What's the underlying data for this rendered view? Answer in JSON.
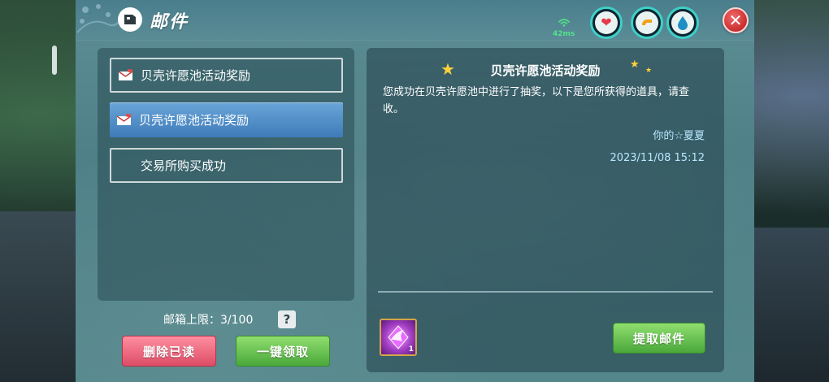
{
  "header": {
    "title": "邮件",
    "ping": "42ms",
    "icons": {
      "mail": "mail-badge-icon",
      "ping": "wifi-signal-icon",
      "mood": "heart-icon",
      "food": "food-icon",
      "water": "water-drop-icon",
      "close": "close-icon"
    }
  },
  "mail_list": {
    "items": [
      {
        "label": "贝壳许愿池活动奖励",
        "icon": "envelope-icon",
        "selected": false
      },
      {
        "label": "贝壳许愿池活动奖励",
        "icon": "envelope-icon",
        "selected": true
      },
      {
        "label": "交易所购买成功",
        "icon": "",
        "selected": false
      }
    ],
    "capacity_label": "邮箱上限：3/100",
    "help_label": "?",
    "delete_read_label": "删除已读",
    "claim_all_label": "一键领取"
  },
  "detail": {
    "title": "贝壳许愿池活动奖励",
    "body": "您成功在贝壳许愿池中进行了抽奖，以下是您所获得的道具，请查收。",
    "sender": "你的☆夏夏",
    "date": "2023/11/08 15:12",
    "attachment": {
      "icon": "winged-crystal-item-icon",
      "count": "1"
    },
    "extract_label": "提取邮件"
  },
  "colors": {
    "selected_item": "#3f7bb9",
    "green_button": "#4aa83b",
    "red_button": "#dc4d66",
    "close_button": "#c92e2e"
  }
}
